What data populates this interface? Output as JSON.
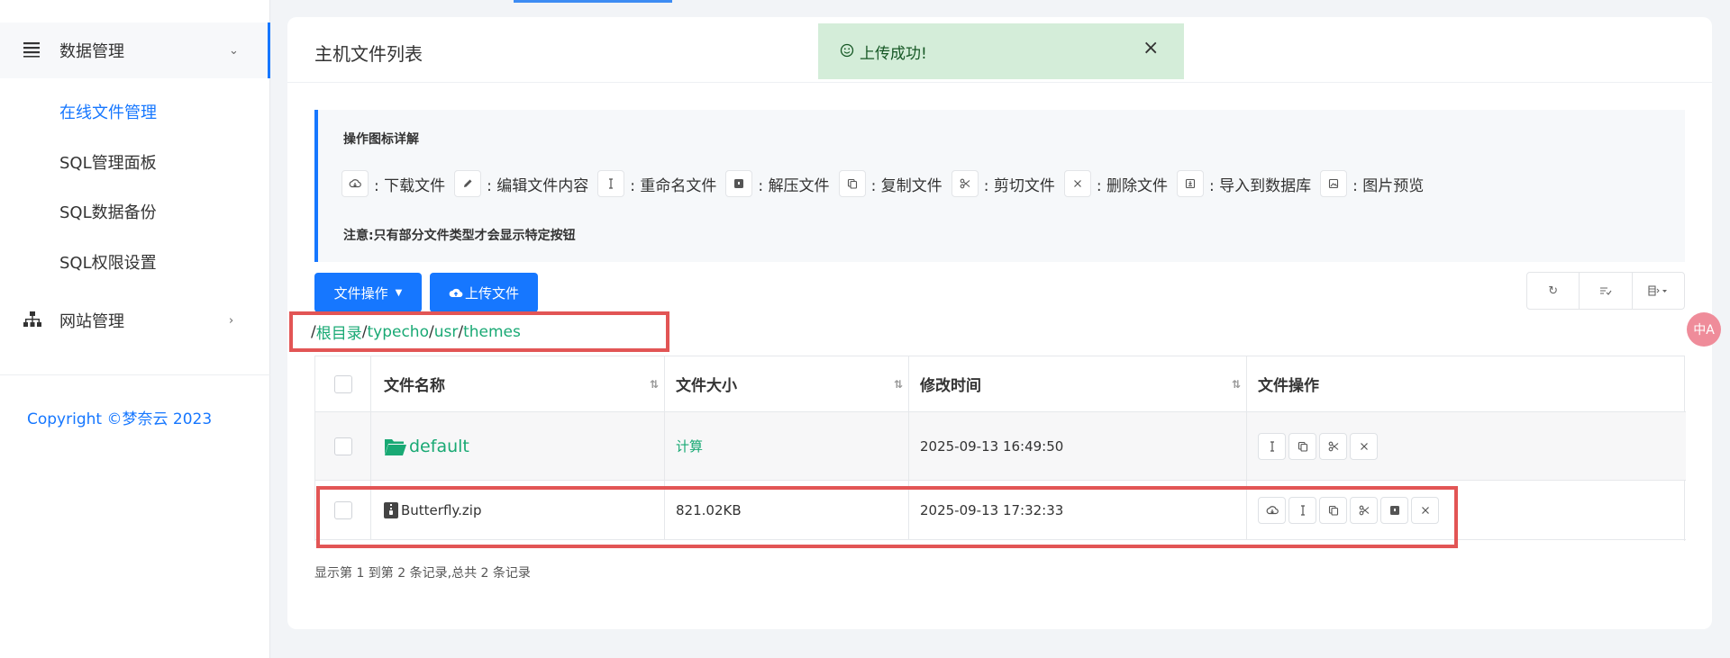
{
  "sidebar": {
    "groups": [
      {
        "label": "数据管理",
        "icon": "list-icon",
        "expanded": true
      },
      {
        "label": "网站管理",
        "icon": "sitemap-icon",
        "expanded": false
      }
    ],
    "sub_items": [
      "在线文件管理",
      "SQL管理面板",
      "SQL数据备份",
      "SQL权限设置"
    ],
    "active_sub": "在线文件管理",
    "copyright": "Copyright ©梦奈云 2023"
  },
  "card": {
    "title": "主机文件列表"
  },
  "toast": {
    "message": "上传成功!",
    "close": "×"
  },
  "help": {
    "title": "操作图标详解",
    "items": [
      {
        "icon": "cloud-download-icon",
        "label": "下载文件"
      },
      {
        "icon": "pencil-icon",
        "label": "编辑文件内容"
      },
      {
        "icon": "cursor-icon",
        "label": "重命名文件"
      },
      {
        "icon": "archive-icon",
        "label": "解压文件"
      },
      {
        "icon": "copy-icon",
        "label": "复制文件"
      },
      {
        "icon": "scissors-icon",
        "label": "剪切文件"
      },
      {
        "icon": "close-icon",
        "label": "删除文件"
      },
      {
        "icon": "import-icon",
        "label": "导入到数据库"
      },
      {
        "icon": "image-icon",
        "label": "图片预览"
      }
    ],
    "separator": ":",
    "note": "注意:只有部分文件类型才会显示特定按钮"
  },
  "toolbar": {
    "file_ops_label": "文件操作",
    "upload_label": "上传文件"
  },
  "path": {
    "root": "根目录",
    "segments": [
      "typecho",
      "usr",
      "themes"
    ],
    "separator": "/"
  },
  "table": {
    "columns": [
      "文件名称",
      "文件大小",
      "修改时间",
      "文件操作"
    ],
    "rows": [
      {
        "name": "default",
        "type": "folder",
        "size": "计算",
        "modified": "2025-09-13 16:49:50"
      },
      {
        "name": "Butterfly.zip",
        "type": "zip",
        "size": "821.02KB",
        "modified": "2025-09-13 17:32:33"
      }
    ],
    "summary": "显示第 1 到第 2 条记录,总共 2 条记录"
  },
  "colors": {
    "primary": "#1677ff",
    "link_green": "#19a974",
    "toast_bg": "#d4edd9",
    "highlight_red": "#e25555"
  },
  "translate_widget": "中A"
}
